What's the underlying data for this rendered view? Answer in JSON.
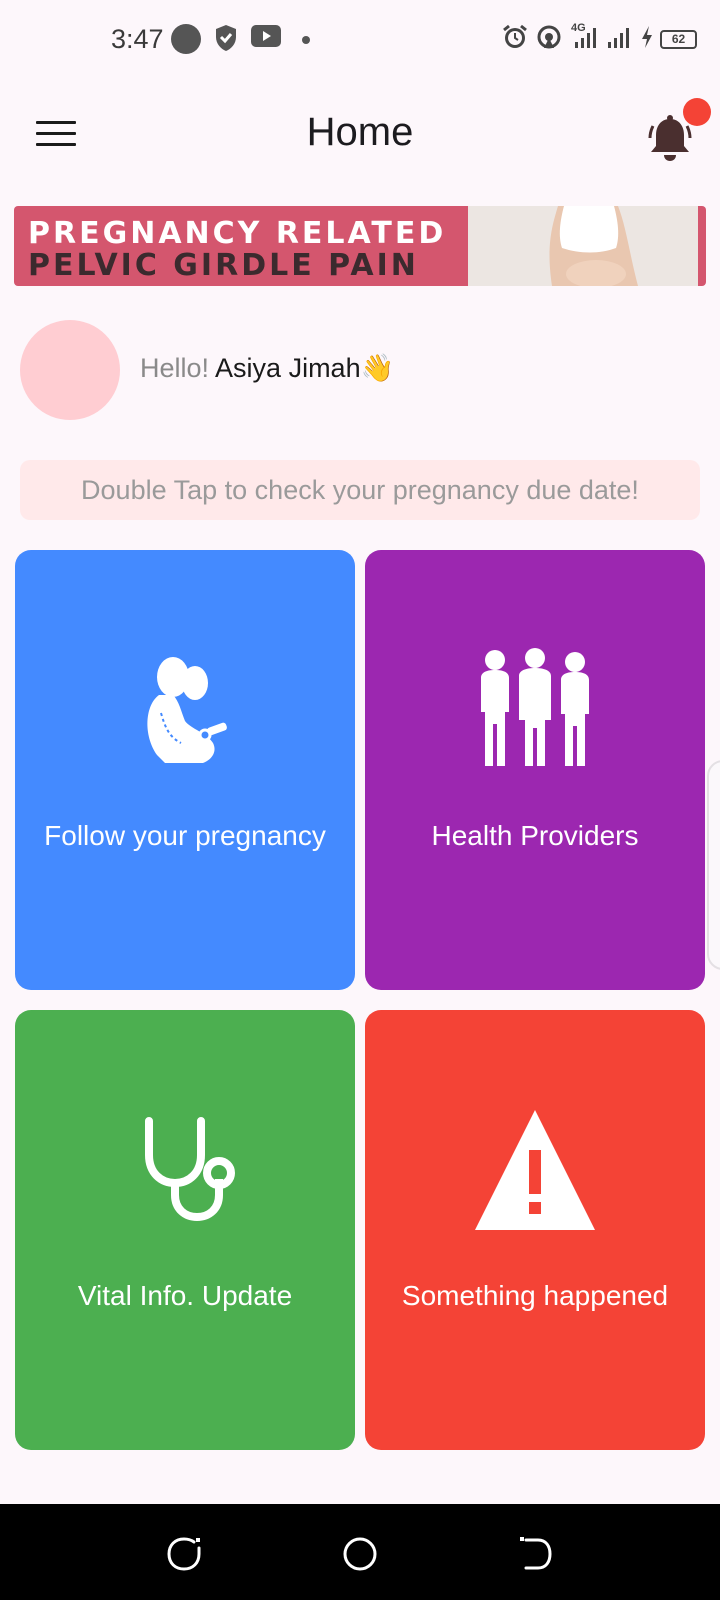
{
  "status_bar": {
    "time": "3:47",
    "network_label": "4G",
    "battery": "62"
  },
  "app_bar": {
    "title": "Home"
  },
  "banner": {
    "line1": "PREGNANCY RELATED",
    "line2": "PELVIC GIRDLE PAIN"
  },
  "greeting": {
    "hello": "Hello!",
    "name": "Asiya Jimah👋"
  },
  "due_date_prompt": "Double Tap to check your pregnancy due date!",
  "tiles": [
    {
      "label": "Follow your pregnancy",
      "color": "#448aff",
      "icon": "pregnant-woman-icon"
    },
    {
      "label": "Health Providers",
      "color": "#9c27b0",
      "icon": "people-group-icon"
    },
    {
      "label": "Vital Info. Update",
      "color": "#4caf50",
      "icon": "stethoscope-icon"
    },
    {
      "label": "Something happened",
      "color": "#f44336",
      "icon": "warning-icon"
    }
  ],
  "colors": {
    "background": "#fdf7fb",
    "avatar": "#ffcdd2",
    "due_date_bg": "#ffe9ea",
    "badge": "#f44336",
    "banner": "#d4566e"
  }
}
